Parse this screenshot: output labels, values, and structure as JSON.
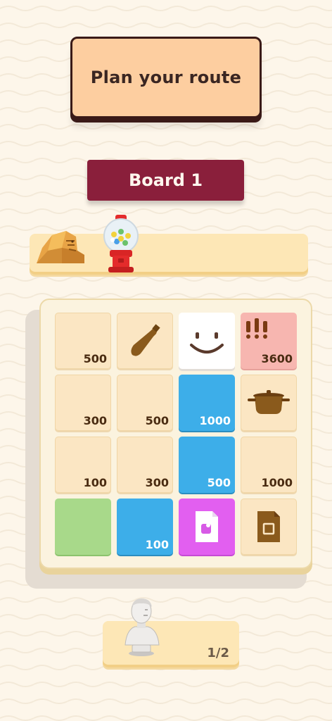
{
  "header": {
    "title": "Plan your route"
  },
  "board": {
    "label": "Board 1"
  },
  "collected": {
    "items": [
      {
        "icon": "sphinx-icon"
      },
      {
        "icon": "gumball-machine-icon"
      }
    ]
  },
  "grid": {
    "tiles": [
      {
        "color": "plain",
        "value": "500",
        "icon": ""
      },
      {
        "color": "plain",
        "value": "",
        "icon": "bottle-icon"
      },
      {
        "color": "white",
        "value": "",
        "icon": "smile-icon"
      },
      {
        "color": "pink",
        "value": "3600",
        "icon": "exclamation-icon"
      },
      {
        "color": "plain",
        "value": "300",
        "icon": ""
      },
      {
        "color": "plain",
        "value": "500",
        "icon": ""
      },
      {
        "color": "blue",
        "value": "1000",
        "icon": ""
      },
      {
        "color": "plain",
        "value": "",
        "icon": "pot-icon"
      },
      {
        "color": "plain",
        "value": "100",
        "icon": ""
      },
      {
        "color": "plain",
        "value": "300",
        "icon": ""
      },
      {
        "color": "blue",
        "value": "500",
        "icon": ""
      },
      {
        "color": "plain",
        "value": "1000",
        "icon": ""
      },
      {
        "color": "green",
        "value": "",
        "icon": ""
      },
      {
        "color": "blue",
        "value": "100",
        "icon": ""
      },
      {
        "color": "magenta",
        "value": "",
        "icon": "white-document-icon"
      },
      {
        "color": "plain",
        "value": "",
        "icon": "document-icon"
      }
    ]
  },
  "progress": {
    "text": "1/2",
    "icon": "bust-statue-icon"
  },
  "colors": {
    "background": "#fdf6ea",
    "title_card": "#fdcea0",
    "board_badge": "#8a1f3b",
    "tile_plain": "#fbe6c3",
    "tile_blue": "#3daee9",
    "tile_pink": "#f7b6b0",
    "tile_green": "#a8d98a",
    "tile_magenta": "#e25ff0"
  }
}
